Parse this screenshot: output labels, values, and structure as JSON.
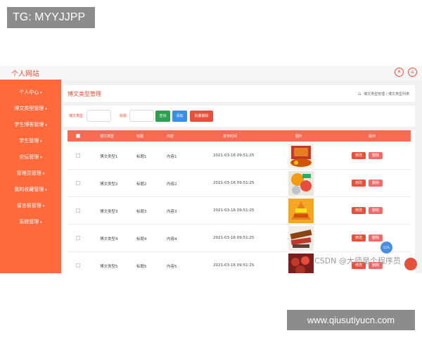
{
  "watermarks": {
    "top": "TG: MYYJJPP",
    "bottom": "www.qiusutiyucn.com",
    "csdn": "CSDN @大师是个程序员"
  },
  "app": {
    "site_title": "个人网站",
    "top_icons": [
      "settings-icon",
      "user-icon"
    ],
    "accent": "#e8503a",
    "sidebar_color": "#ff6a3d"
  },
  "sidebar": {
    "items": [
      {
        "label": "个人中心"
      },
      {
        "label": "博文类型管理"
      },
      {
        "label": "学生博客管理"
      },
      {
        "label": "学生管理"
      },
      {
        "label": "论坛管理"
      },
      {
        "label": "管理员管理"
      },
      {
        "label": "我的收藏管理"
      },
      {
        "label": "留言板管理"
      },
      {
        "label": "系统管理"
      }
    ]
  },
  "header": {
    "page_title": "博文类型管理",
    "breadcrumb": [
      "博文类型管理",
      "博文类型列表"
    ]
  },
  "search": {
    "type_label": "博文类型",
    "title_label": "标题",
    "query_button": "查询",
    "add_button": "添加",
    "batch_delete_button": "批量删除"
  },
  "table": {
    "columns": [
      "博文类型",
      "标题",
      "内容",
      "发布时间",
      "图片",
      "操作"
    ],
    "rows": [
      {
        "type": "博文类型1",
        "title": "标题1",
        "content": "内容1",
        "time": "2021-03-16 09:51:25"
      },
      {
        "type": "博文类型2",
        "title": "标题2",
        "content": "内容2",
        "time": "2021-03-16 09:51:25"
      },
      {
        "type": "博文类型3",
        "title": "标题3",
        "content": "内容3",
        "time": "2021-03-16 09:51:25"
      },
      {
        "type": "博文类型4",
        "title": "标题4",
        "content": "内容4",
        "time": "2021-03-16 09:51:25"
      },
      {
        "type": "博文类型5",
        "title": "标题5",
        "content": "内容5",
        "time": "2021-03-16 09:51:25"
      }
    ],
    "edit_label": "修改",
    "delete_label": "删除"
  },
  "fab_label": "51%"
}
